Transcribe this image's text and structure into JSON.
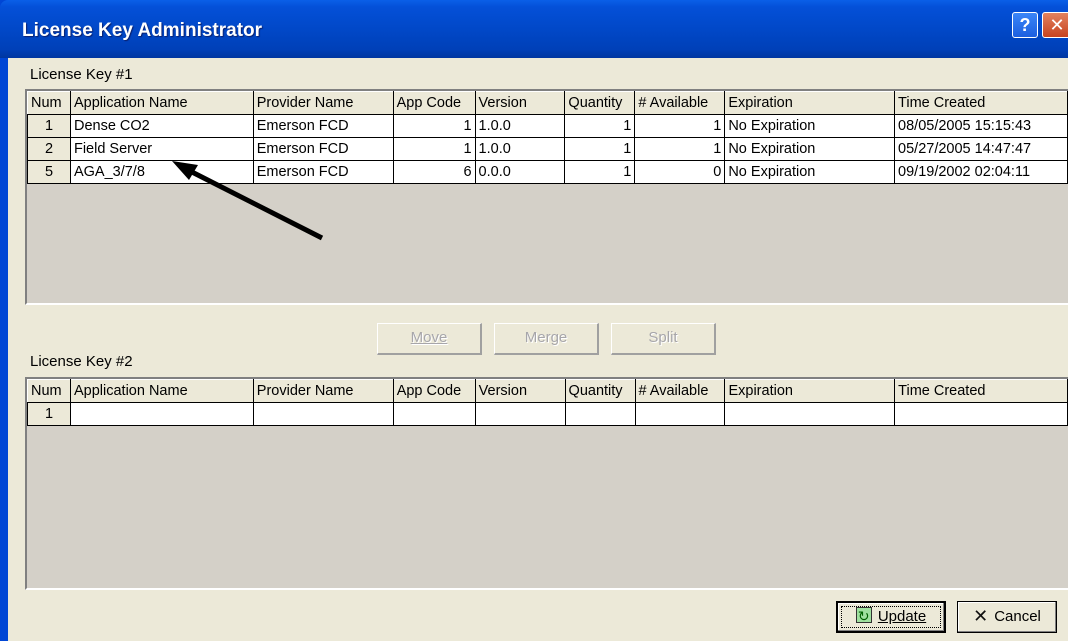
{
  "window": {
    "title": "License Key Administrator",
    "help_glyph": "?",
    "close_glyph": "✕"
  },
  "columns": [
    "Num",
    "Application Name",
    "Provider Name",
    "App Code",
    "Version",
    "Quantity",
    "# Available",
    "Expiration",
    "Time Created"
  ],
  "key1": {
    "label": "License Key #1",
    "rows": [
      {
        "num": "1",
        "app": "Dense CO2",
        "provider": "Emerson FCD",
        "code": "1",
        "version": "1.0.0",
        "qty": "1",
        "avail": "1",
        "exp": "No Expiration",
        "created": "08/05/2005 15:15:43"
      },
      {
        "num": "2",
        "app": "Field Server",
        "provider": "Emerson FCD",
        "code": "1",
        "version": "1.0.0",
        "qty": "1",
        "avail": "1",
        "exp": "No Expiration",
        "created": "05/27/2005 14:47:47"
      },
      {
        "num": "5",
        "app": "AGA_3/7/8",
        "provider": "Emerson FCD",
        "code": "6",
        "version": "0.0.0",
        "qty": "1",
        "avail": "0",
        "exp": "No Expiration",
        "created": "09/19/2002 02:04:11"
      }
    ]
  },
  "key2": {
    "label": "License Key #2",
    "rows": [
      {
        "num": "1",
        "app": "",
        "provider": "",
        "code": "",
        "version": "",
        "qty": "",
        "avail": "",
        "exp": "",
        "created": ""
      }
    ]
  },
  "buttons": {
    "move": "Move",
    "merge": "Merge",
    "split": "Split",
    "update": "Update",
    "cancel": "Cancel"
  },
  "icons": {
    "update": "update-icon",
    "cancel": "cancel-x-icon"
  }
}
